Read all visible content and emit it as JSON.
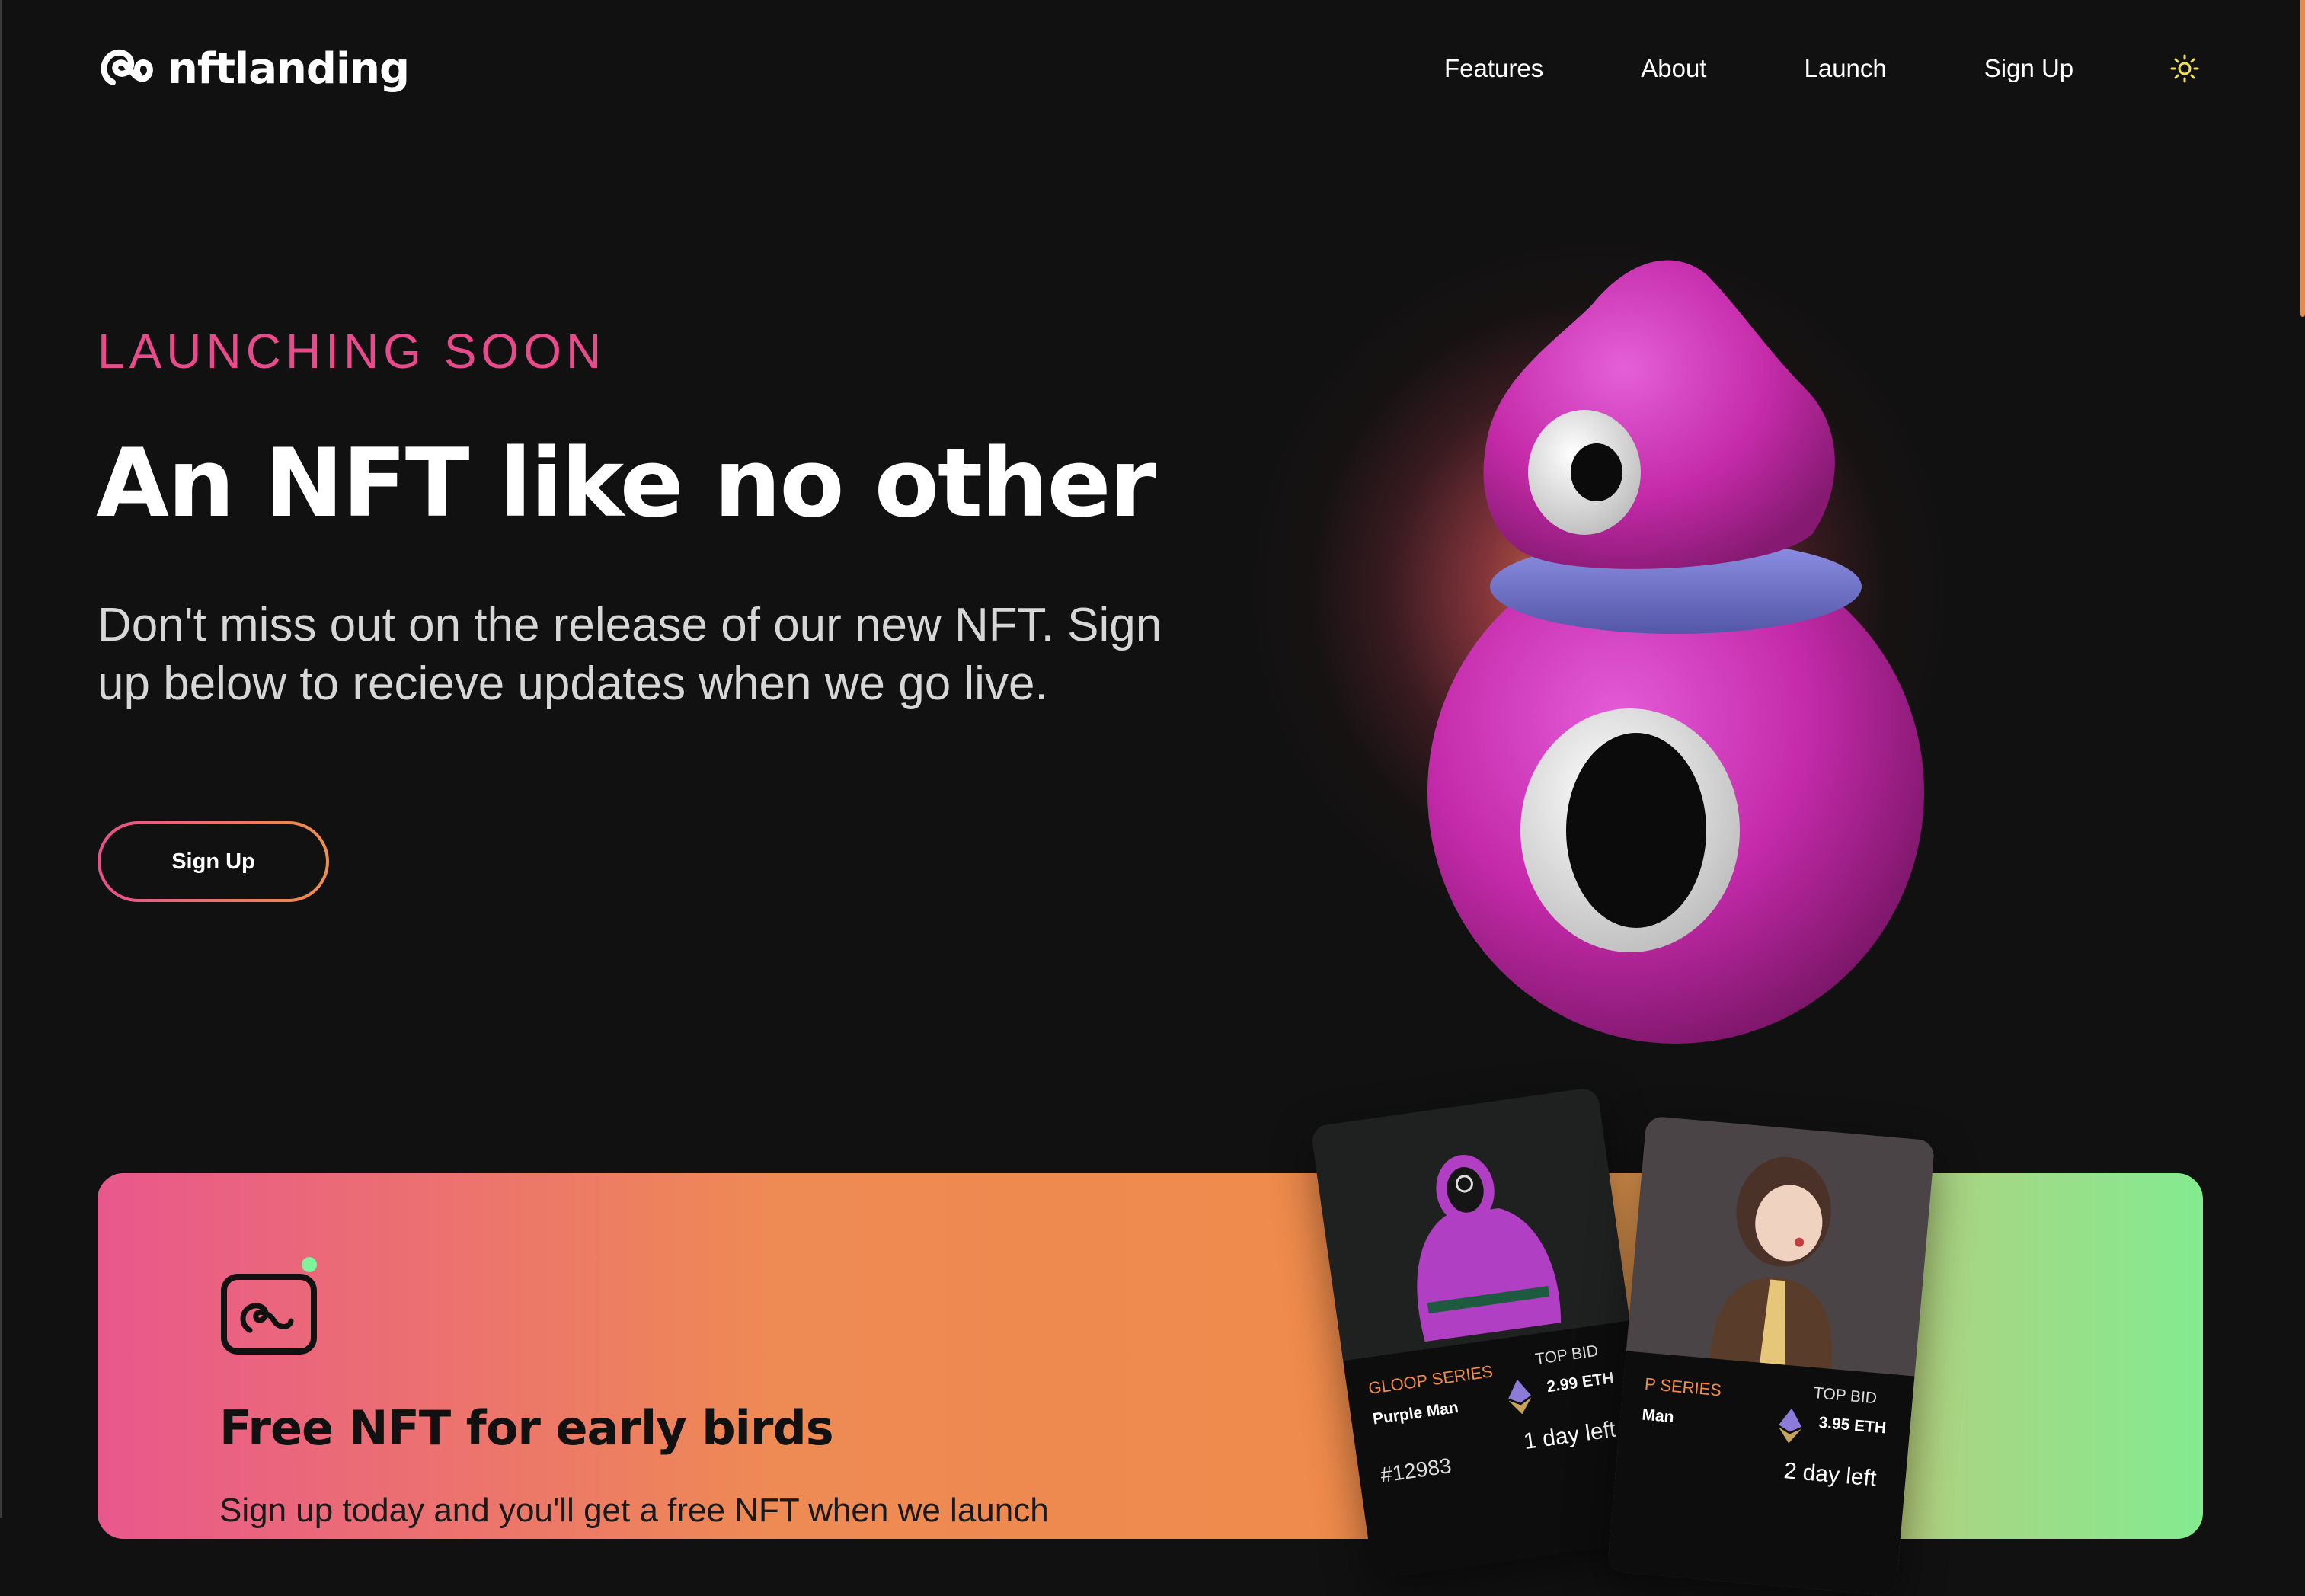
{
  "brand": {
    "name": "nftlanding",
    "logo_icon": "swirl-logo-icon"
  },
  "nav": {
    "links": [
      "Features",
      "About",
      "Launch",
      "Sign Up"
    ],
    "theme_toggle_icon": "sun-icon"
  },
  "hero": {
    "eyebrow": "LAUNCHING SOON",
    "title": "An NFT like no other",
    "subtitle": "Don't miss out on the release of our new NFT. Sign up below to recieve updates when we go live.",
    "cta_label": "Sign Up",
    "image": "pink-cyclops-mascot"
  },
  "feature": {
    "icon": "app-swirl-icon",
    "title": "Free NFT for early birds",
    "description": "Sign up today and you'll get a free NFT when we launch"
  },
  "nft_cards": [
    {
      "series": "GLOOP SERIES",
      "name": "Purple Man",
      "top_bid_label": "TOP BID",
      "price": "2.99 ETH",
      "token_id": "#12983",
      "time_left": "1 day left"
    },
    {
      "series": "P SERIES",
      "name": "Man",
      "top_bid_label": "TOP BID",
      "price": "3.95 ETH",
      "time_left": "2 day left"
    }
  ],
  "colors": {
    "background": "#111111",
    "accent_pink": "#e84a8c",
    "accent_orange": "#f0904a",
    "accent_green": "#83eb90"
  }
}
